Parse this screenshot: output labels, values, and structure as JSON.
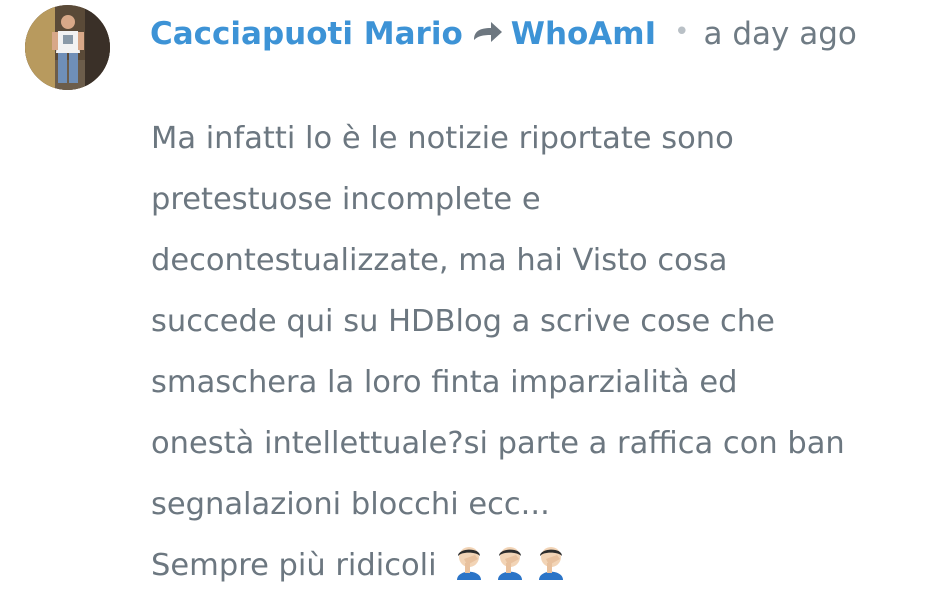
{
  "comment": {
    "author": "Cacciapuoti Mario",
    "reply_to": "WhoAmI",
    "separator": "•",
    "timestamp": "a day ago",
    "body_lines": [
      "Ma infatti lo è le notizie riportate sono",
      "pretestuose incomplete e",
      "decontestualizzate, ma hai Visto cosa",
      "succede qui su HDBlog a scrive cose che",
      "smaschera la loro finta imparzialità ed",
      "onestà intellettuale?si parte a raffica con ban",
      "segnalazioni blocchi ecc...",
      "Sempre più ridicoli"
    ],
    "emoji": [
      "facepalm-emoji",
      "facepalm-emoji",
      "facepalm-emoji"
    ],
    "colors": {
      "author": "#3d93d6",
      "body_text": "#6c7780",
      "timestamp": "#6f7b84"
    },
    "icons": {
      "reply": "reply-arrow-icon"
    }
  }
}
